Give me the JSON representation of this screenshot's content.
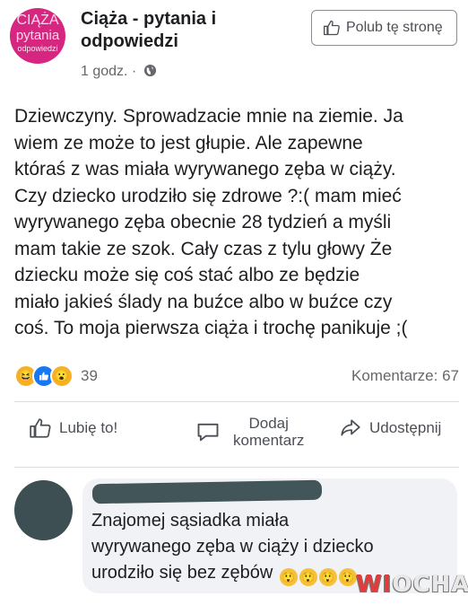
{
  "page": {
    "logo": {
      "line1": "CIĄŻA",
      "line2": "pytania",
      "line3": "odpowiedzi"
    },
    "name_line1": "Ciąża - pytania i",
    "name_line2": "odpowiedzi",
    "time": "1 godz. ·",
    "like_page_label": "Polub tę stronę"
  },
  "post": {
    "lines": [
      "Dziewczyny. Sprowadzacie mnie na ziemie. Ja",
      "wiem ze może to jest głupie. Ale zapewne",
      "któraś z was miała wyrywanego zęba w ciąży.",
      "Czy dziecko urodziło się zdrowe ?:( mam mieć",
      "wyrywanego zęba obecnie 28 tydzień a myśli",
      "mam takie ze szok. Cały czas z tylu głowy Że",
      "dziecku może się coś stać  albo ze będzie",
      "miało jakieś ślady na buźce albo w buźce czy",
      "coś. To moja pierwsza ciąża i trochę panikuje ;("
    ],
    "reaction_count": "39",
    "comments_label": "Komentarze: 67"
  },
  "actions": {
    "like": "Lubię to!",
    "comment_line1": "Dodaj",
    "comment_line2": "komentarz",
    "share": "Udostępnij"
  },
  "comment": {
    "lines": [
      "Znajomej sąsiadka miała",
      "wyrywanego zęba w ciąży i dziecko",
      "urodziło się bez zębów"
    ]
  },
  "watermark": {
    "part1": "WI",
    "part2": "OCHA"
  },
  "colors": {
    "accent": "#1877f2",
    "logo": "#d6267f",
    "reaction": "#f7b125"
  }
}
